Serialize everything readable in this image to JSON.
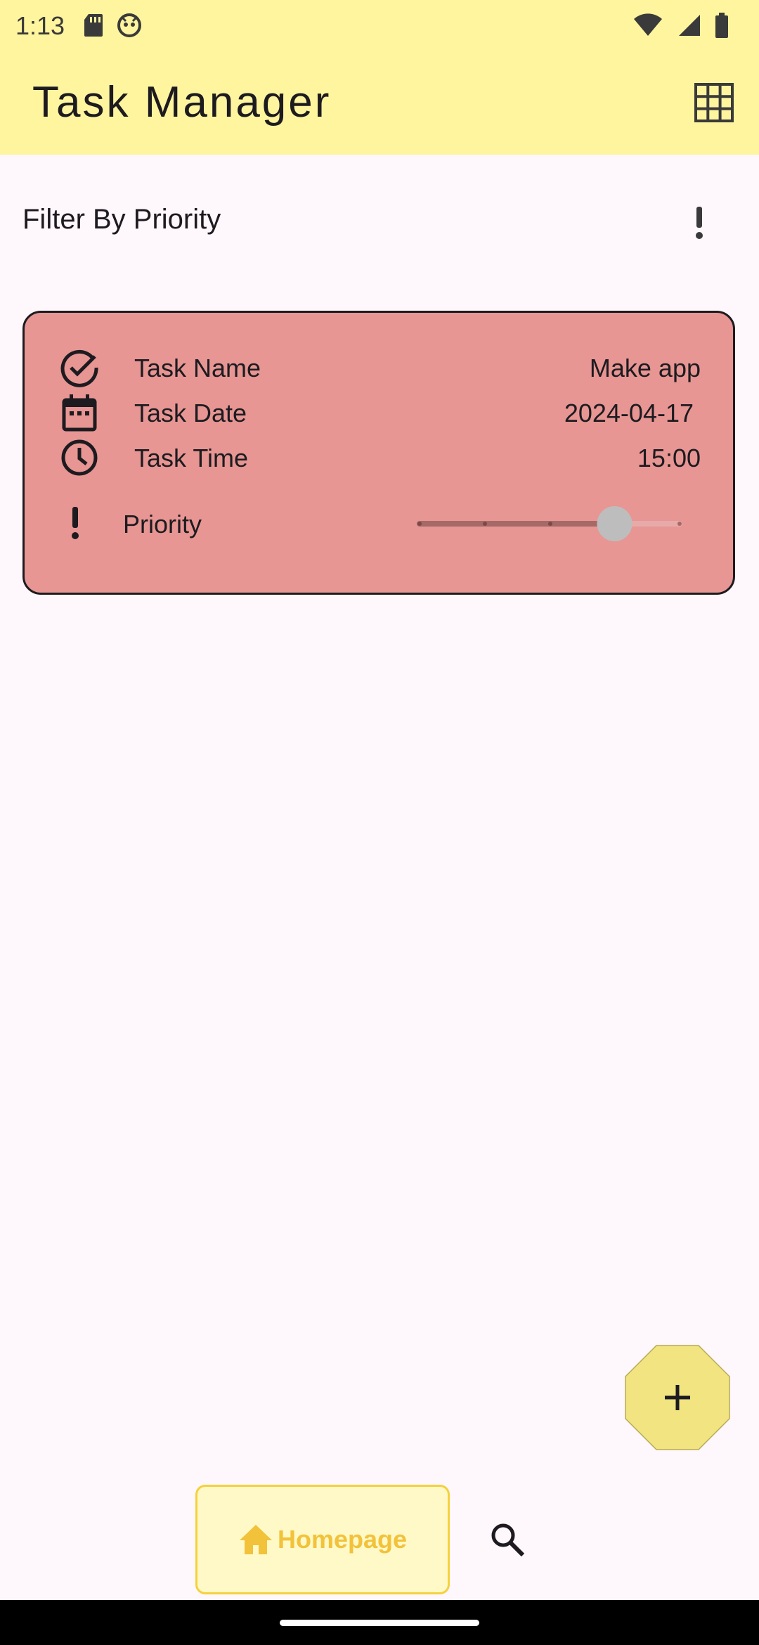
{
  "status": {
    "time": "1:13"
  },
  "appbar": {
    "title": "Task Manager",
    "grid_icon": "grid-view-icon"
  },
  "filter": {
    "label": "Filter By Priority",
    "icon": "priority-exclamation-icon"
  },
  "task": {
    "name_label": "Task Name",
    "name_value": "Make app",
    "date_label": "Task Date",
    "date_value": "2024-04-17",
    "time_label": "Task Time",
    "time_value": "15:00",
    "priority_label": "Priority",
    "priority_value_fraction": 0.75,
    "card_color": "#e79693"
  },
  "fab": {
    "icon": "plus-icon",
    "color": "#f1e481"
  },
  "bottom_nav": {
    "home_label": "Homepage",
    "home_icon": "home-icon",
    "search_icon": "search-icon",
    "accent": "#f2c23a"
  }
}
